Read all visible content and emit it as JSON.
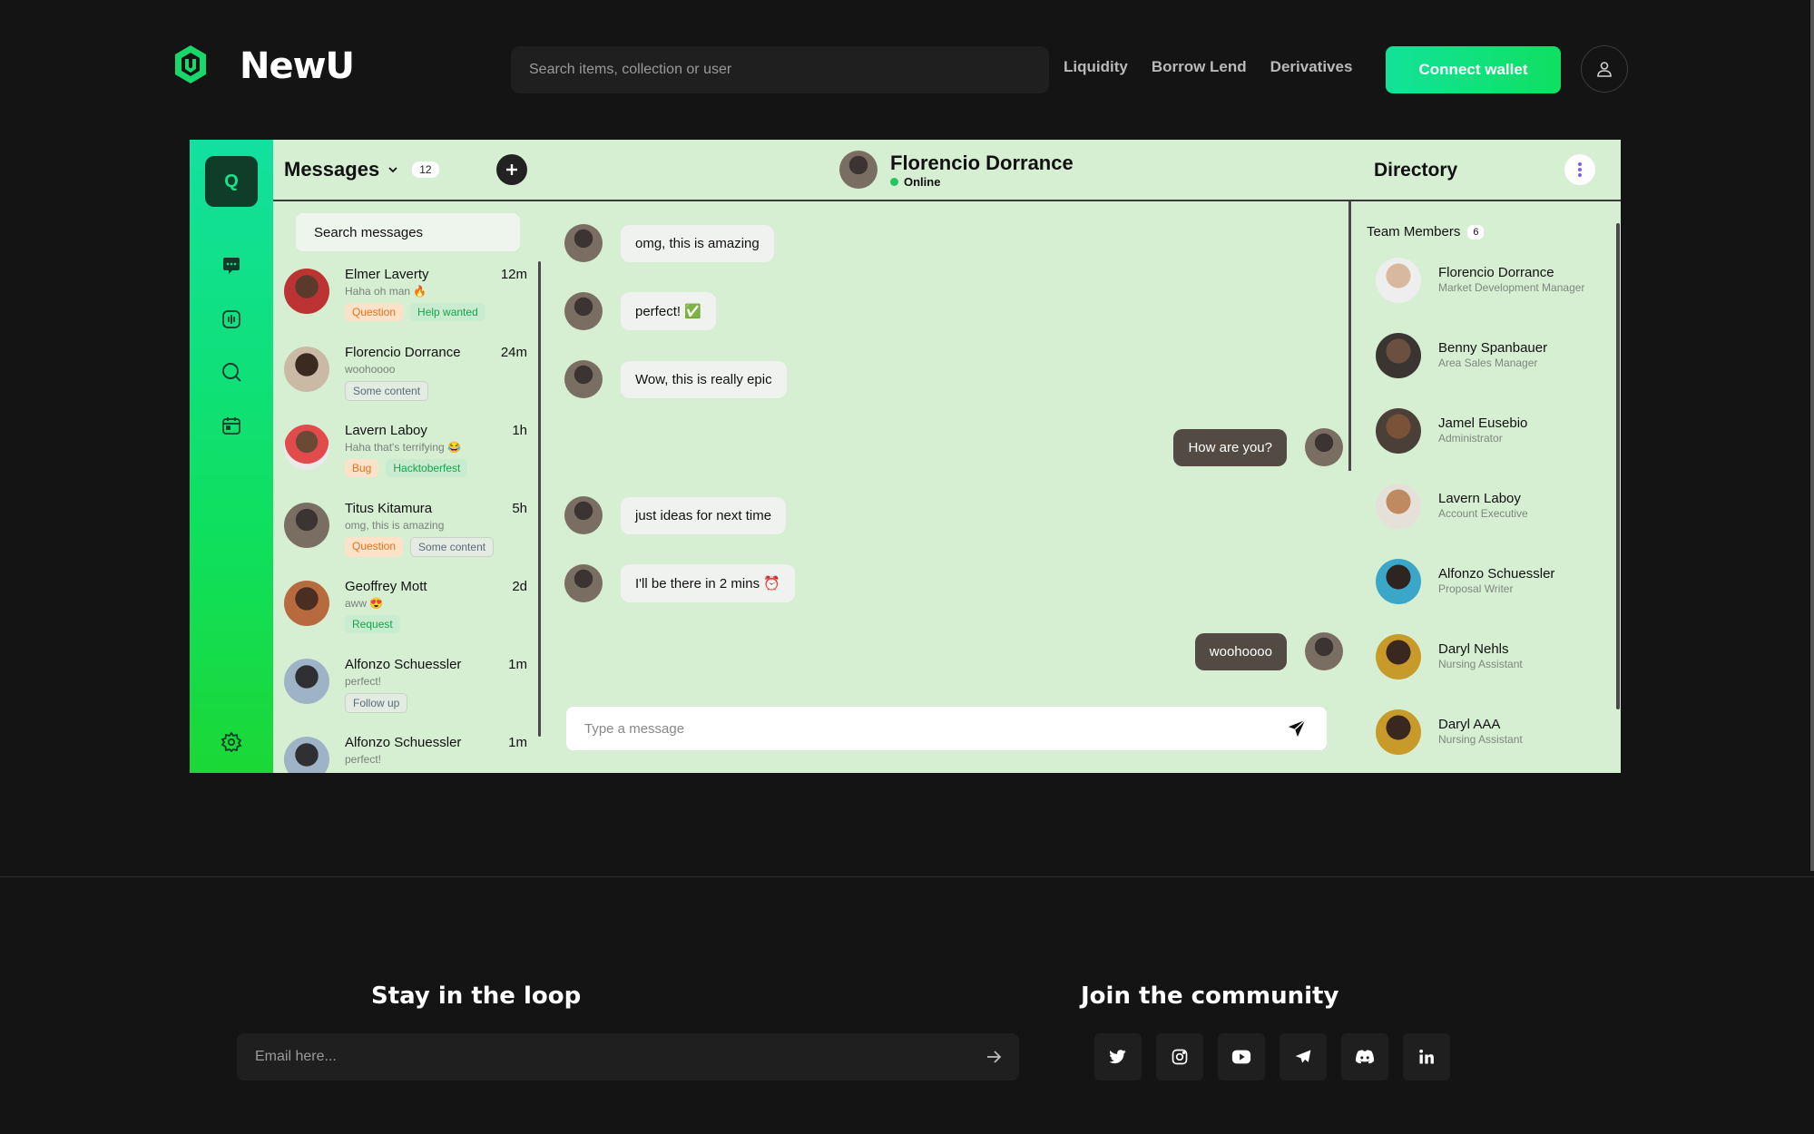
{
  "header": {
    "brand": "NewU",
    "search_placeholder": "Search items, collection or user",
    "nav": [
      "Liquidity",
      "Borrow Lend",
      "Derivatives"
    ],
    "connect_label": "Connect wallet"
  },
  "colors": {
    "accent": "#12e29a",
    "accent_dark": "#0fe060",
    "panel_bg": "#d6efd3",
    "outgoing_bubble": "#524a43"
  },
  "rail": {
    "logo_letter": "Q",
    "icons": [
      "chat-icon",
      "voice-icon",
      "search-icon",
      "calendar-icon",
      "gear-icon"
    ]
  },
  "messages": {
    "title": "Messages",
    "count": "12",
    "search_label": "Search messages",
    "conversations": [
      {
        "name": "Elmer Laverty",
        "time": "12m",
        "preview": "Haha oh man 🔥",
        "tags": [
          {
            "label": "Question",
            "kind": "orange"
          },
          {
            "label": "Help wanted",
            "kind": "green"
          }
        ]
      },
      {
        "name": "Florencio Dorrance",
        "time": "24m",
        "preview": "woohoooo",
        "tags": [
          {
            "label": "Some content",
            "kind": "gray"
          }
        ]
      },
      {
        "name": "Lavern Laboy",
        "time": "1h",
        "preview": "Haha that's terrifying 😂",
        "tags": [
          {
            "label": "Bug",
            "kind": "orange"
          },
          {
            "label": "Hacktoberfest",
            "kind": "green"
          }
        ]
      },
      {
        "name": "Titus Kitamura",
        "time": "5h",
        "preview": "omg, this is amazing",
        "tags": [
          {
            "label": "Question",
            "kind": "orange"
          },
          {
            "label": "Some content",
            "kind": "gray"
          }
        ]
      },
      {
        "name": "Geoffrey Mott",
        "time": "2d",
        "preview": "aww 😍",
        "tags": [
          {
            "label": "Request",
            "kind": "green"
          }
        ]
      },
      {
        "name": "Alfonzo Schuessler",
        "time": "1m",
        "preview": "perfect!",
        "tags": [
          {
            "label": "Follow up",
            "kind": "gray"
          }
        ]
      },
      {
        "name": "Alfonzo Schuessler",
        "time": "1m",
        "preview": "perfect!",
        "tags": []
      }
    ]
  },
  "chat": {
    "user_name": "Florencio Dorrance",
    "status": "Online",
    "messages": [
      {
        "text": "omg, this is amazing",
        "dir": "in"
      },
      {
        "text": "perfect! ✅",
        "dir": "in"
      },
      {
        "text": "Wow, this is really epic",
        "dir": "in"
      },
      {
        "text": "How are you?",
        "dir": "out"
      },
      {
        "text": "just ideas for next time",
        "dir": "in"
      },
      {
        "text": "I'll be there in 2 mins ⏰",
        "dir": "in"
      },
      {
        "text": "woohoooo",
        "dir": "out"
      }
    ],
    "composer_placeholder": "Type a message"
  },
  "directory": {
    "title": "Directory",
    "team_label": "Team Members",
    "team_count": "6",
    "members": [
      {
        "name": "Florencio Dorrance",
        "role": "Market Development Manager"
      },
      {
        "name": "Benny Spanbauer",
        "role": "Area Sales Manager"
      },
      {
        "name": "Jamel Eusebio",
        "role": "Administrator"
      },
      {
        "name": "Lavern Laboy",
        "role": "Account Executive"
      },
      {
        "name": "Alfonzo Schuessler",
        "role": "Proposal Writer"
      },
      {
        "name": "Daryl Nehls",
        "role": "Nursing Assistant"
      },
      {
        "name": "Daryl AAA",
        "role": "Nursing Assistant"
      }
    ]
  },
  "footer": {
    "stay_title": "Stay in the loop",
    "email_placeholder": "Email here...",
    "join_title": "Join the community",
    "socials": [
      "twitter-icon",
      "instagram-icon",
      "youtube-icon",
      "telegram-icon",
      "discord-icon",
      "linkedin-icon"
    ]
  }
}
